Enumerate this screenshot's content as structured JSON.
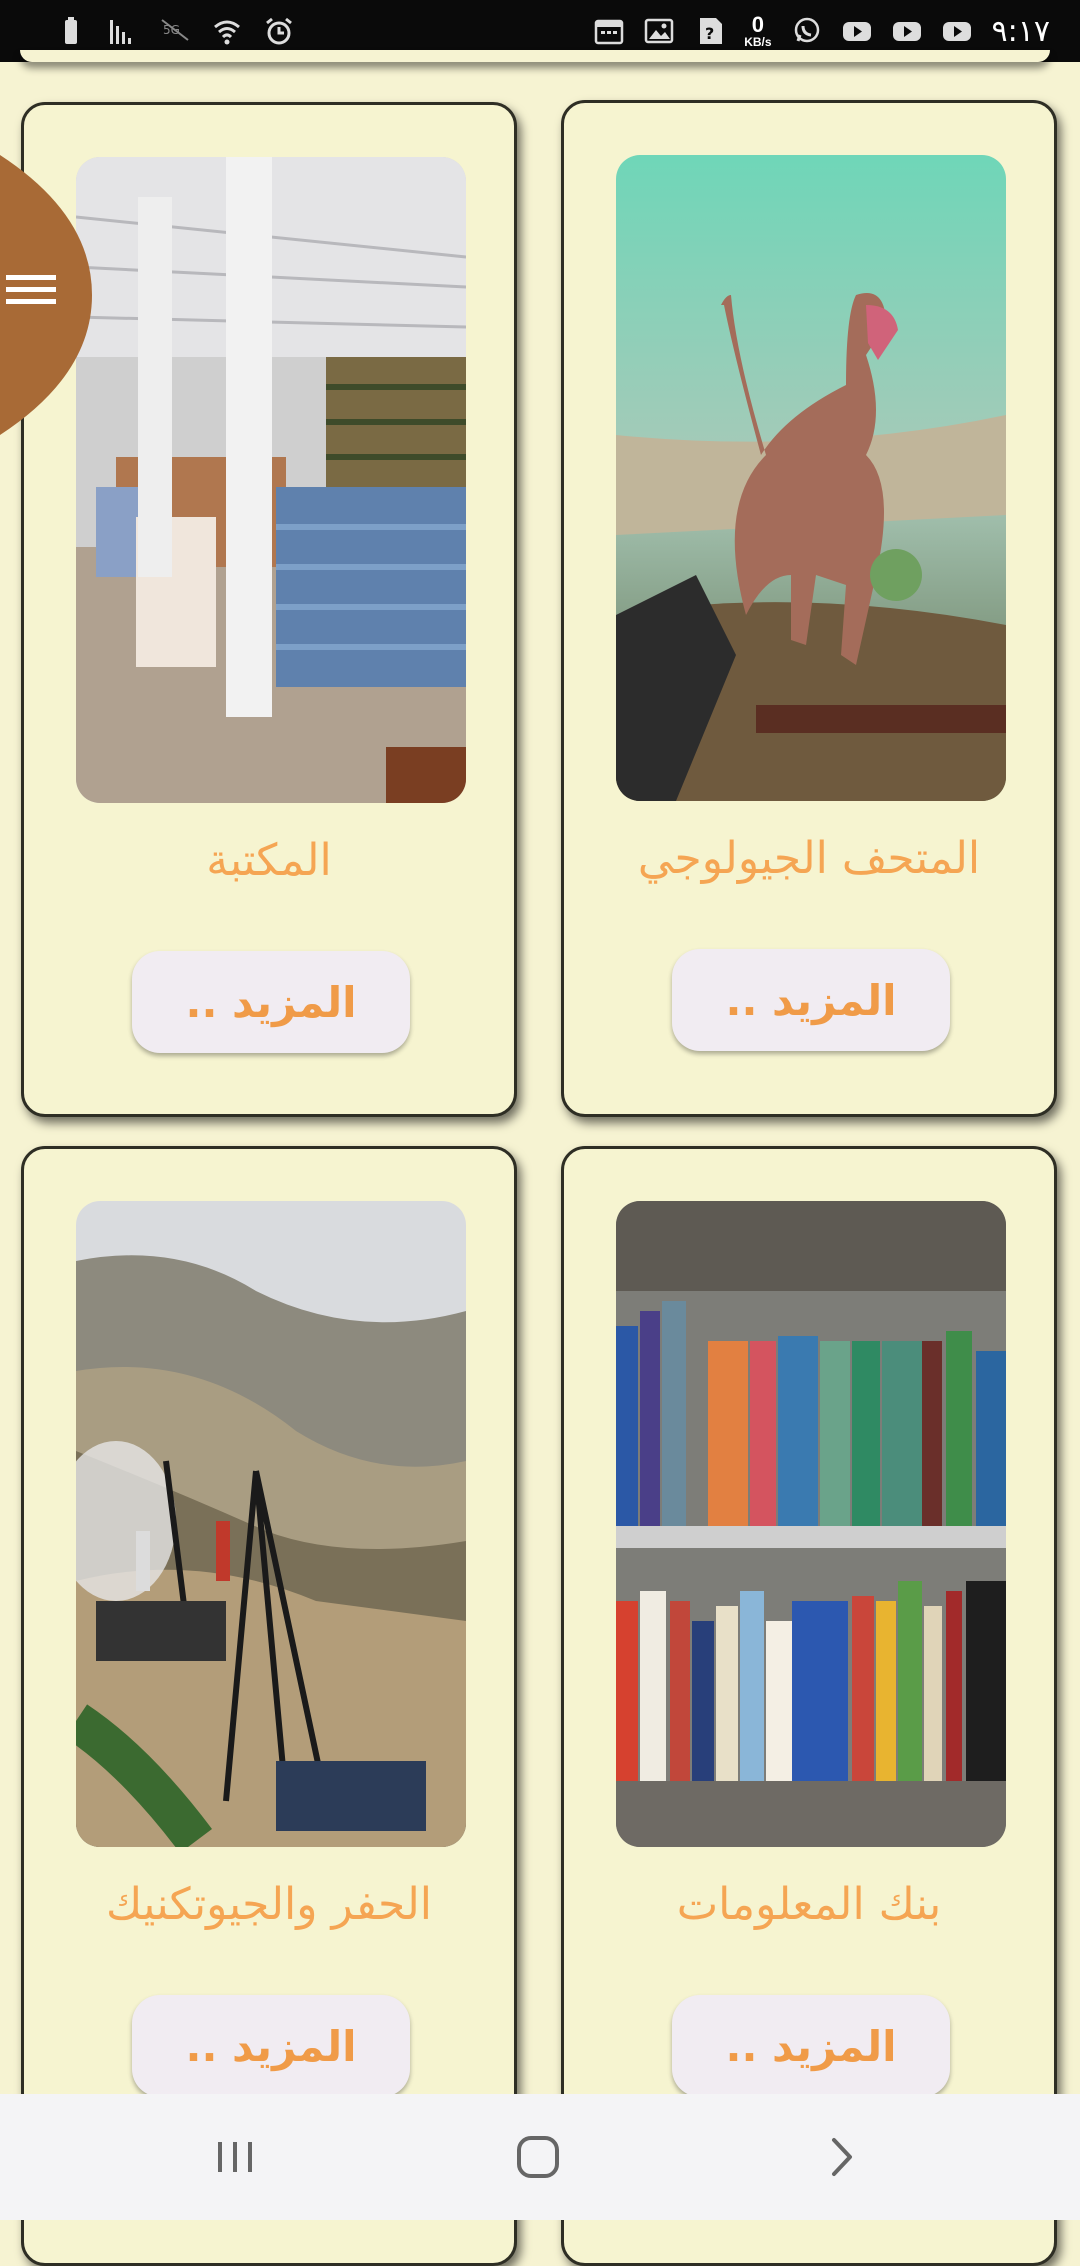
{
  "status_bar": {
    "clock": "٩:١٧",
    "data_speed_value": "0",
    "data_speed_unit": "KB/s",
    "left_icons": [
      "battery-icon",
      "signal-bars-icon",
      "no-5g-icon",
      "wifi-icon",
      "alarm-icon"
    ],
    "right_icons": [
      "calendar-icon",
      "gallery-icon",
      "help-icon",
      "data-speed",
      "whatsapp-icon",
      "youtube-icon",
      "youtube-icon",
      "youtube-icon"
    ]
  },
  "cards": [
    {
      "title": "المكتبة",
      "button_label": "المزيد .."
    },
    {
      "title": "المتحف الجيولوجي",
      "button_label": "المزيد .."
    },
    {
      "title": "الحفر والجيوتكنيك",
      "button_label": "المزيد .."
    },
    {
      "title": "بنك المعلومات",
      "button_label": "المزيد .."
    }
  ],
  "colors": {
    "background": "#f6f3d2",
    "title": "#f5a553",
    "button_text": "#f09b48",
    "button_bg": "#f1ecf2",
    "menu_tab": "#a86a36"
  },
  "menu_icon": "hamburger-icon",
  "nav_bar": {
    "icons": [
      "recent-apps-icon",
      "home-icon",
      "back-icon"
    ]
  }
}
